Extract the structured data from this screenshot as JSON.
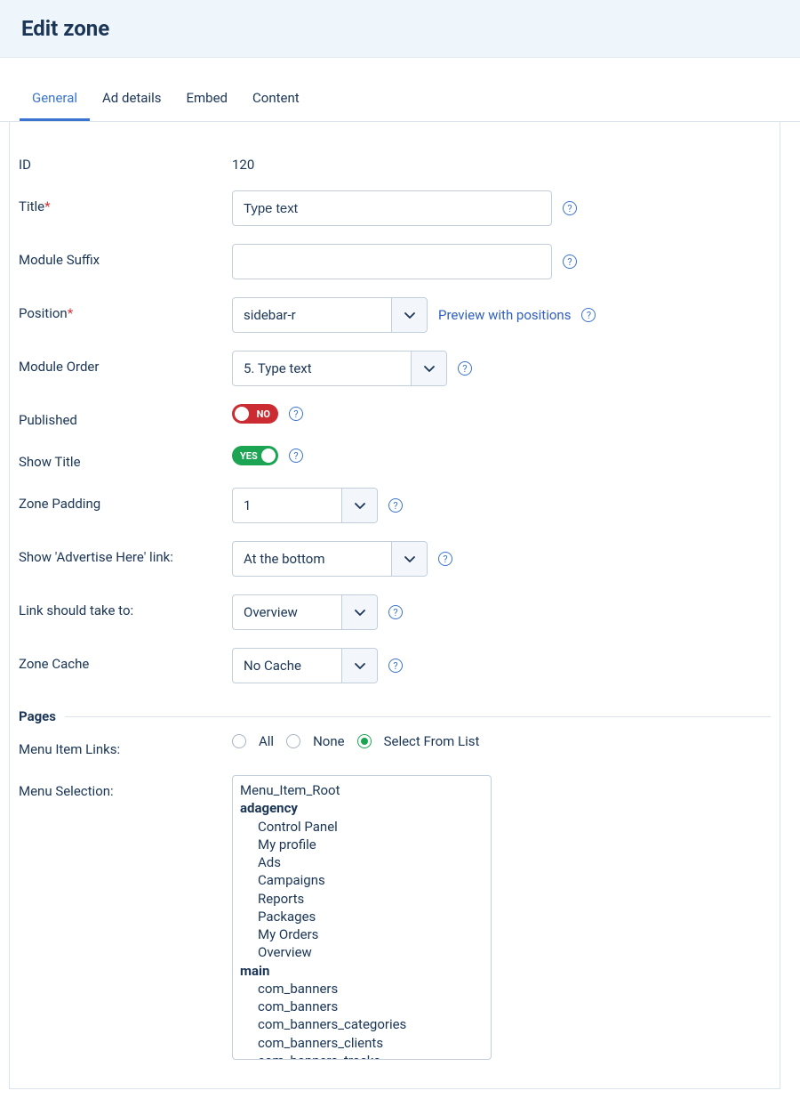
{
  "header": {
    "title": "Edit zone"
  },
  "tabs": [
    {
      "label": "General",
      "active": true
    },
    {
      "label": "Ad details",
      "active": false
    },
    {
      "label": "Embed",
      "active": false
    },
    {
      "label": "Content",
      "active": false
    }
  ],
  "general": {
    "id_label": "ID",
    "id_value": "120",
    "title_label": "Title",
    "title_value": "Type text",
    "module_suffix_label": "Module Suffix",
    "module_suffix_value": "",
    "position_label": "Position",
    "position_value": "sidebar-r",
    "preview_link": "Preview with positions",
    "module_order_label": "Module Order",
    "module_order_value": "5. Type text",
    "published_label": "Published",
    "published_value": "NO",
    "show_title_label": "Show Title",
    "show_title_value": "YES",
    "zone_padding_label": "Zone Padding",
    "zone_padding_value": "1",
    "advertise_link_label": "Show 'Advertise Here' link:",
    "advertise_link_value": "At the bottom",
    "link_take_label": "Link should take to:",
    "link_take_value": "Overview",
    "zone_cache_label": "Zone Cache",
    "zone_cache_value": "No Cache"
  },
  "pages": {
    "section_title": "Pages",
    "menu_item_links_label": "Menu Item Links:",
    "options": {
      "all": "All",
      "none": "None",
      "select": "Select From List"
    },
    "selected": "select",
    "menu_selection_label": "Menu Selection:",
    "items": [
      {
        "level": 0,
        "bold": false,
        "text": "Menu_Item_Root"
      },
      {
        "level": 0,
        "bold": true,
        "text": "adagency"
      },
      {
        "level": 2,
        "bold": false,
        "text": "Control Panel"
      },
      {
        "level": 2,
        "bold": false,
        "text": "My profile"
      },
      {
        "level": 2,
        "bold": false,
        "text": "Ads"
      },
      {
        "level": 2,
        "bold": false,
        "text": "Campaigns"
      },
      {
        "level": 2,
        "bold": false,
        "text": "Reports"
      },
      {
        "level": 2,
        "bold": false,
        "text": "Packages"
      },
      {
        "level": 2,
        "bold": false,
        "text": "My Orders"
      },
      {
        "level": 2,
        "bold": false,
        "text": "Overview"
      },
      {
        "level": 0,
        "bold": true,
        "text": "main"
      },
      {
        "level": 2,
        "bold": false,
        "text": "com_banners"
      },
      {
        "level": 2,
        "bold": false,
        "text": "com_banners"
      },
      {
        "level": 2,
        "bold": false,
        "text": "com_banners_categories"
      },
      {
        "level": 2,
        "bold": false,
        "text": "com_banners_clients"
      },
      {
        "level": 2,
        "bold": false,
        "text": "com_banners_tracks"
      }
    ]
  }
}
